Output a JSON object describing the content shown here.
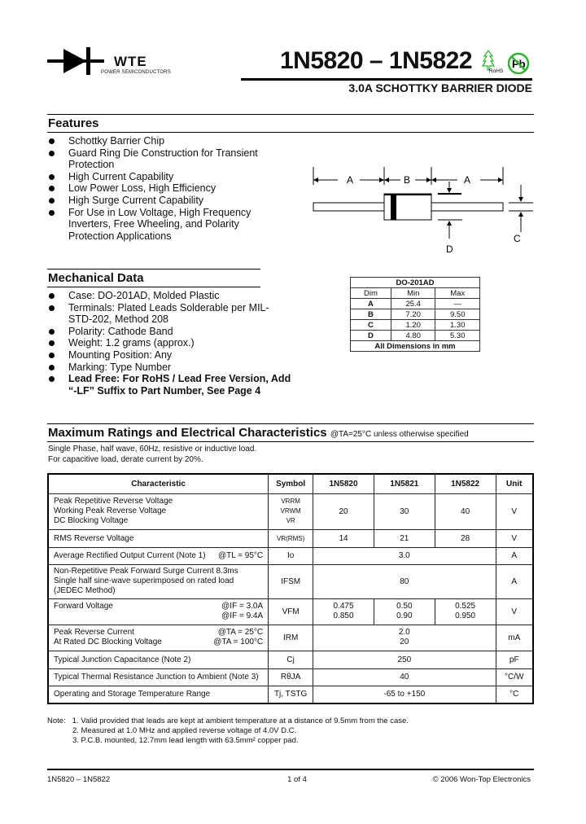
{
  "header": {
    "logo_text": "WTE",
    "logo_subtitle": "POWER SEMICONDUCTORS",
    "title": "1N5820 – 1N5822",
    "rohs_label": "RoHS",
    "pb_label": "Pb",
    "subtitle": "3.0A SCHOTTKY BARRIER DIODE",
    "icons": [
      "diode-logo-icon",
      "rohs-tree-icon",
      "pb-free-icon"
    ],
    "colors": {
      "rohs_green": "#2db52d",
      "text": "#111111"
    }
  },
  "features": {
    "title": "Features",
    "items": [
      "Schottky Barrier Chip",
      "Guard Ring Die Construction for Transient Protection",
      "High Current Capability",
      "Low Power Loss, High Efficiency",
      "High Surge Current Capability",
      "For Use in Low Voltage, High Frequency Inverters, Free Wheeling, and Polarity Protection Applications"
    ]
  },
  "diagram": {
    "labels": {
      "a_left": "A",
      "b": "B",
      "a_right": "A",
      "c": "C",
      "d": "D"
    }
  },
  "mechanical": {
    "title": "Mechanical Data",
    "items": [
      "Case: DO-201AD, Molded Plastic",
      "Terminals: Plated Leads Solderable per MIL-STD-202, Method 208",
      "Polarity: Cathode Band",
      "Weight: 1.2 grams (approx.)",
      "Mounting Position: Any",
      "Marking: Type Number"
    ],
    "bold_item": "Lead Free: For RoHS / Lead Free Version, Add “-LF” Suffix to Part Number, See Page 4"
  },
  "dim_table": {
    "package": "DO-201AD",
    "headers": [
      "Dim",
      "Min",
      "Max"
    ],
    "rows": [
      [
        "A",
        "25.4",
        "—"
      ],
      [
        "B",
        "7.20",
        "9.50"
      ],
      [
        "C",
        "1.20",
        "1.30"
      ],
      [
        "D",
        "4.80",
        "5.30"
      ]
    ],
    "footer": "All Dimensions in mm"
  },
  "ratings": {
    "title": "Maximum Ratings and Electrical Characteristics",
    "condition": "@TA=25°C unless otherwise specified",
    "note_line1": "Single Phase, half wave, 60Hz, resistive or inductive load.",
    "note_line2": "For capacitive load, derate current by 20%.",
    "headers": [
      "Characteristic",
      "Symbol",
      "1N5820",
      "1N5821",
      "1N5822",
      "Unit"
    ],
    "rows": {
      "vr": {
        "char": [
          "Peak Repetitive Reverse Voltage",
          "Working Peak Reverse Voltage",
          "DC Blocking Voltage"
        ],
        "sym": [
          "VRRM",
          "VRWM",
          "VR"
        ],
        "v": [
          "20",
          "30",
          "40"
        ],
        "unit": "V"
      },
      "vrms": {
        "char": "RMS Reverse Voltage",
        "sym": "VR(RMS)",
        "v": [
          "14",
          "21",
          "28"
        ],
        "unit": "V"
      },
      "io": {
        "char": "Average Rectified Output Current (Note 1)",
        "cond": "@TL = 95°C",
        "sym": "Io",
        "v": "3.0",
        "unit": "A"
      },
      "ifsm": {
        "char": [
          "Non-Repetitive Peak Forward Surge Current 8.3ms",
          "Single half sine-wave superimposed on rated load",
          "(JEDEC Method)"
        ],
        "sym": "IFSM",
        "v": "80",
        "unit": "A"
      },
      "vfm": {
        "char": "Forward Voltage",
        "cond": [
          "@IF = 3.0A",
          "@IF = 9.4A"
        ],
        "sym": "VFM",
        "v1": [
          "0.475",
          "0.850"
        ],
        "v2": [
          "0.50",
          "0.90"
        ],
        "v3": [
          "0.525",
          "0.950"
        ],
        "unit": "V"
      },
      "irm": {
        "char": [
          "Peak Reverse Current",
          "At Rated DC Blocking Voltage"
        ],
        "cond": [
          "@TA = 25°C",
          "@TA = 100°C"
        ],
        "sym": "IRM",
        "v": [
          "2.0",
          "20"
        ],
        "unit": "mA"
      },
      "cj": {
        "char": "Typical Junction Capacitance (Note 2)",
        "sym": "Cj",
        "v": "250",
        "unit": "pF"
      },
      "rth": {
        "char": "Typical Thermal Resistance Junction to Ambient (Note 3)",
        "sym": "RθJA",
        "v": "40",
        "unit": "°C/W"
      },
      "temp": {
        "char": "Operating and Storage Temperature Range",
        "sym": "Tj, TSTG",
        "v": "-65 to +150",
        "unit": "°C"
      }
    }
  },
  "notes": {
    "label": "Note:",
    "items": [
      "1. Valid provided that leads are kept at ambient temperature at a distance of 9.5mm from the case.",
      "2. Measured at 1.0 MHz and applied reverse voltage of 4.0V D.C.",
      "3. P.C.B. mounted, 12.7mm lead length with 63.5mm² copper pad."
    ]
  },
  "footer": {
    "left": "1N5820 – 1N5822",
    "center": "1 of 4",
    "right": "© 2006 Won-Top Electronics"
  }
}
